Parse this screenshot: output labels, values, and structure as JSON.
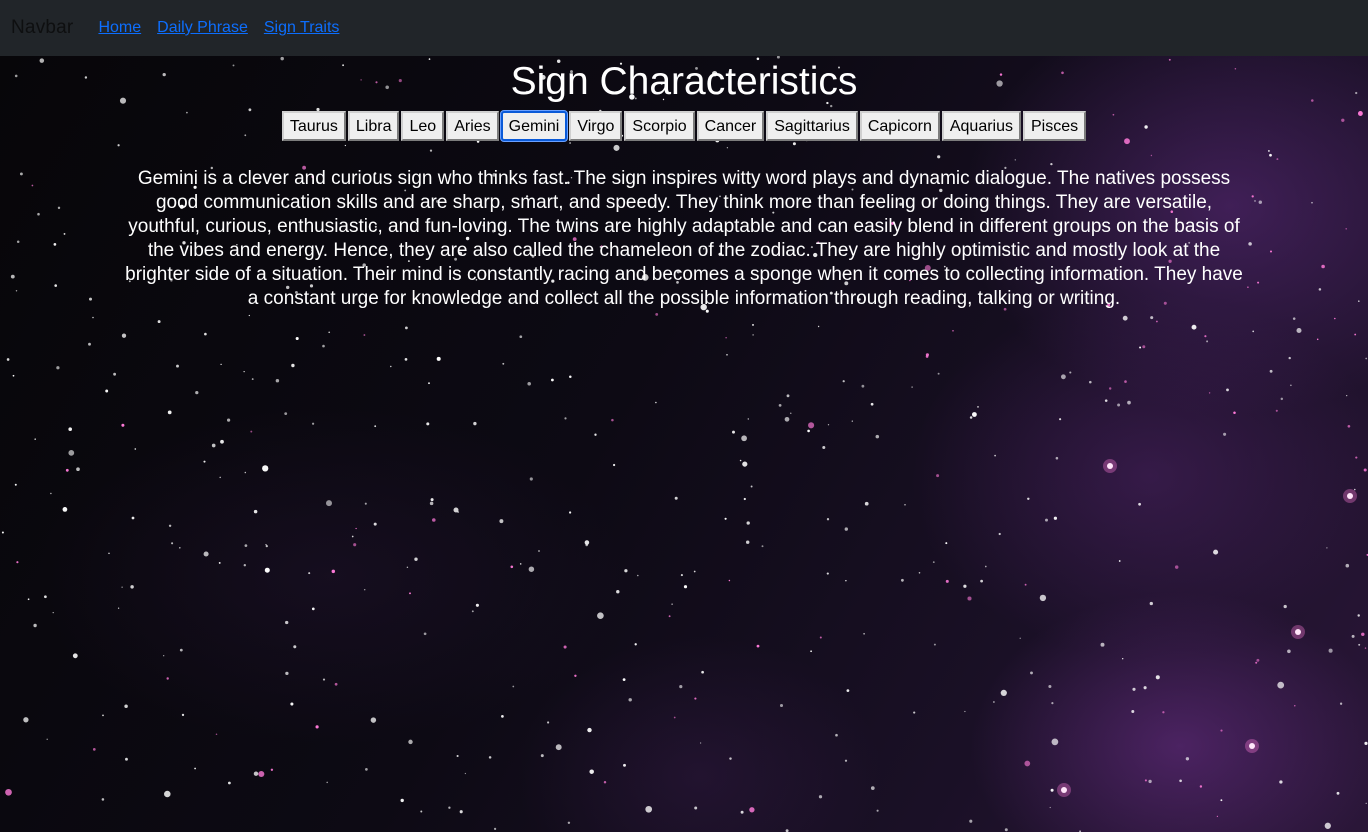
{
  "navbar": {
    "brand": "Navbar",
    "links": [
      "Home",
      "Daily Phrase",
      "Sign Traits"
    ]
  },
  "page": {
    "title": "Sign Characteristics",
    "selected_sign": "Gemini"
  },
  "signs": [
    "Taurus",
    "Libra",
    "Leo",
    "Aries",
    "Gemini",
    "Virgo",
    "Scorpio",
    "Cancer",
    "Sagittarius",
    "Capicorn",
    "Aquarius",
    "Pisces"
  ],
  "description": "Gemini is a clever and curious sign who thinks fast. The sign inspires witty word plays and dynamic dialogue. The natives possess good communication skills and are sharp, smart, and speedy. They think more than feeling or doing things. They are versatile, youthful, curious, enthusiastic, and fun-loving. The twins are highly adaptable and can easily blend in different groups on the basis of the vibes and energy. Hence, they are also called the chameleon of the zodiac. They are highly optimistic and mostly look at the brighter side of a situation. Their mind is constantly racing and becomes a sponge when it comes to collecting information. They have a constant urge for knowledge and collect all the possible information through reading, talking or writing.",
  "colors": {
    "navbar_bg": "#212529",
    "link": "#0d6efd",
    "active_border": "#0a5ad8",
    "star_pink": "#ff7ad9"
  }
}
